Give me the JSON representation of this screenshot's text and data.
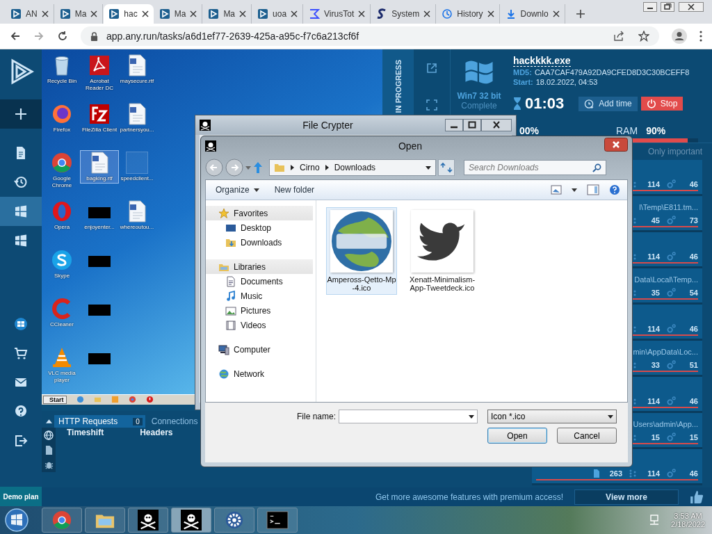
{
  "browser": {
    "tabs": [
      {
        "label": "AN",
        "kind": "anyrun",
        "selected": false
      },
      {
        "label": "Ma",
        "kind": "anyrun",
        "selected": false
      },
      {
        "label": "hac",
        "kind": "anyrun",
        "selected": true
      },
      {
        "label": "Ma",
        "kind": "anyrun",
        "selected": false
      },
      {
        "label": "Ma",
        "kind": "anyrun",
        "selected": false
      },
      {
        "label": "uoa",
        "kind": "anyrun",
        "selected": false
      },
      {
        "label": "VirusTot",
        "kind": "sigma",
        "selected": false
      },
      {
        "label": "System",
        "kind": "s-logo",
        "selected": false
      },
      {
        "label": "History",
        "kind": "history",
        "selected": false
      },
      {
        "label": "Downlo",
        "kind": "download",
        "selected": false
      }
    ],
    "address": "app.any.run/tasks/a6d1ef77-2639-425a-a95c-f7c6a213cf6f"
  },
  "sidebar": {
    "items": [
      {
        "kind": "plus",
        "selected": false
      },
      {
        "kind": "file",
        "selected": false
      },
      {
        "kind": "history",
        "selected": false
      },
      {
        "kind": "windows",
        "selected": true
      },
      {
        "kind": "windows",
        "selected": false
      },
      {
        "kind": "orb",
        "selected": false
      },
      {
        "kind": "cart",
        "selected": false
      },
      {
        "kind": "mail",
        "selected": false
      },
      {
        "kind": "help",
        "selected": false
      },
      {
        "kind": "exit",
        "selected": false
      }
    ],
    "plan": "Demo plan"
  },
  "desktop": {
    "icons": [
      {
        "kind": "recycle",
        "label": "Recycle Bin",
        "selected": false
      },
      {
        "kind": "firefox",
        "label": "Firefox",
        "selected": false
      },
      {
        "kind": "chrome",
        "label": "Google Chrome",
        "selected": false
      },
      {
        "kind": "opera",
        "label": "Opera",
        "selected": false
      },
      {
        "kind": "skype",
        "label": "Skype",
        "selected": false
      },
      {
        "kind": "ccleaner",
        "label": "CCleaner",
        "selected": false
      },
      {
        "kind": "vlc",
        "label": "VLC media player",
        "selected": false
      },
      {
        "kind": "pdf",
        "label": "Acrobat Reader DC",
        "selected": false
      },
      {
        "kind": "filezilla",
        "label": "FileZilla Client",
        "selected": false
      },
      {
        "kind": "doc",
        "label": "bagking.rtf",
        "selected": true
      },
      {
        "kind": "redacted",
        "label": "enjoyenter...",
        "selected": false
      },
      {
        "kind": "redacted",
        "selected": false
      },
      {
        "kind": "redacted",
        "selected": false
      },
      {
        "kind": "redacted",
        "selected": false
      },
      {
        "kind": "doc",
        "label": "maysecure.rtf",
        "selected": false
      },
      {
        "kind": "doc",
        "label": "partnersyou...",
        "selected": false
      },
      {
        "kind": "blank",
        "label": "speedclient...",
        "selected": false
      },
      {
        "kind": "doc",
        "label": "whereoutou...",
        "selected": false
      }
    ],
    "taskbar": {
      "start": "Start",
      "icons": [
        {
          "kind": "ie"
        },
        {
          "kind": "folder"
        },
        {
          "kind": "media"
        },
        {
          "kind": "chrome"
        },
        {
          "kind": "stop"
        }
      ]
    }
  },
  "task": {
    "status": "IN PROGRESS",
    "os": "Win7 32 bit",
    "os_state": "Complete",
    "file": "hackkkk.exe",
    "md5_label": "MD5:",
    "md5": "CAA7CAF479A92DA9CFED8D3C30BCEFF8",
    "start_label": "Start:",
    "start": "18.02.2022, 04:53",
    "timer": "01:03",
    "add_time": "Add time",
    "stop": "Stop",
    "cpu_reading": "00%",
    "ram": {
      "label": "RAM",
      "reading": "90%",
      "level": 0.9
    },
    "filter": "Only important",
    "processes": [
      {
        "a": "114",
        "b": "46"
      },
      {
        "path": "l\\Temp\\E811.tm...",
        "a": "45",
        "b": "73"
      },
      {
        "a": "114",
        "b": "46"
      },
      {
        "path": "Data\\Local\\Temp...",
        "a": "35",
        "b": "54"
      },
      {
        "a": "114",
        "b": "46"
      },
      {
        "path": "min\\AppData\\Loc...",
        "a": "33",
        "b": "51"
      },
      {
        "a": "114",
        "b": "46"
      },
      {
        "path": "Users\\admin\\App...",
        "a": "15",
        "b": "15"
      },
      {
        "files": "263",
        "a": "114",
        "b": "46"
      }
    ]
  },
  "bottom_panel": {
    "tabs": [
      {
        "label": "HTTP Requests",
        "count": "0",
        "selected": true
      },
      {
        "label": "Connections",
        "selected": false
      }
    ],
    "columns": [
      "Timeshift",
      "Headers"
    ]
  },
  "promo": {
    "text": "Get more awesome features with premium access!",
    "button": "View more"
  },
  "file_crypter": {
    "title": "File Crypter"
  },
  "open_dialog": {
    "title": "Open",
    "path": [
      "Cirno",
      "Downloads"
    ],
    "search_placeholder": "Search Downloads",
    "toolbar": [
      "Organize",
      "New folder"
    ],
    "nav": [
      {
        "label": "Favorites",
        "kind": "star",
        "children": [
          {
            "label": "Desktop",
            "kind": "desktop"
          },
          {
            "label": "Downloads",
            "kind": "downloads"
          }
        ]
      },
      {
        "label": "Libraries",
        "kind": "library",
        "children": [
          {
            "label": "Documents",
            "kind": "documents"
          },
          {
            "label": "Music",
            "kind": "music"
          },
          {
            "label": "Pictures",
            "kind": "pictures"
          },
          {
            "label": "Videos",
            "kind": "videos"
          }
        ]
      },
      {
        "label": "Computer",
        "kind": "computer"
      },
      {
        "label": "Network",
        "kind": "network"
      }
    ],
    "files": [
      {
        "name": "Ampeross-Qetto-Mp-4.ico",
        "kind": "globe",
        "selected": true
      },
      {
        "name": "Xenatt-Minimalism-App-Tweetdeck.ico",
        "kind": "bird",
        "selected": false
      }
    ],
    "file_name_label": "File name:",
    "file_type": "Icon *.ico",
    "buttons": [
      "Open",
      "Cancel"
    ]
  },
  "taskbar": {
    "apps": [
      {
        "kind": "chrome",
        "selected": false
      },
      {
        "kind": "explorer",
        "selected": false
      },
      {
        "kind": "pirate",
        "selected": false
      },
      {
        "kind": "pirate",
        "selected": true
      },
      {
        "kind": "gear",
        "selected": false
      },
      {
        "kind": "console",
        "selected": false
      }
    ],
    "time": "3:53 AM",
    "date": "2/18/2022"
  }
}
